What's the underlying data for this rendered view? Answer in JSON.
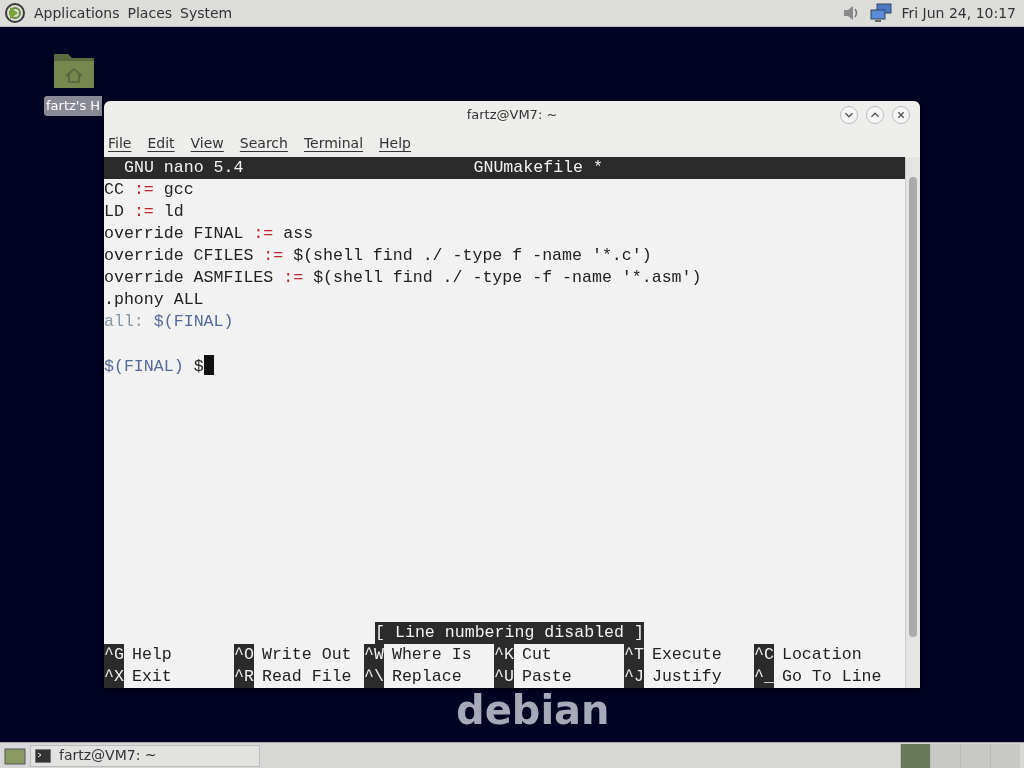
{
  "top_panel": {
    "menus": [
      "Applications",
      "Places",
      "System"
    ],
    "clock": "Fri Jun 24, 10:17"
  },
  "desktop": {
    "icons": [
      {
        "label": "fartz's H"
      }
    ],
    "wallpaper_text": "debian"
  },
  "window": {
    "title": "fartz@VM7: ~",
    "menu": [
      "File",
      "Edit",
      "View",
      "Search",
      "Terminal",
      "Help"
    ]
  },
  "nano": {
    "version": "GNU nano 5.4",
    "filename": "GNUmakefile *",
    "lines": [
      {
        "kind": "code",
        "segments": [
          {
            "text": "CC ",
            "kind": "plain"
          },
          {
            "text": ":=",
            "kind": "operator"
          },
          {
            "text": " gcc",
            "kind": "plain"
          }
        ]
      },
      {
        "kind": "code",
        "segments": [
          {
            "text": "LD ",
            "kind": "plain"
          },
          {
            "text": ":=",
            "kind": "operator"
          },
          {
            "text": " ld",
            "kind": "plain"
          }
        ]
      },
      {
        "kind": "code",
        "segments": [
          {
            "text": "override FINAL ",
            "kind": "plain"
          },
          {
            "text": ":=",
            "kind": "operator"
          },
          {
            "text": " ass",
            "kind": "plain"
          }
        ]
      },
      {
        "kind": "code",
        "segments": [
          {
            "text": "override CFILES ",
            "kind": "plain"
          },
          {
            "text": ":=",
            "kind": "operator"
          },
          {
            "text": " $(shell find ./ -type f -name '*.c')",
            "kind": "plain"
          }
        ]
      },
      {
        "kind": "code",
        "segments": [
          {
            "text": "override ASMFILES ",
            "kind": "plain"
          },
          {
            "text": ":=",
            "kind": "operator"
          },
          {
            "text": " $(shell find ./ -type -f -name '*.asm')",
            "kind": "plain"
          }
        ]
      },
      {
        "kind": "code",
        "segments": [
          {
            "text": ".phony ALL",
            "kind": "plain"
          }
        ]
      },
      {
        "kind": "code",
        "segments": [
          {
            "text": "all:",
            "kind": "target"
          },
          {
            "text": " $(FINAL)",
            "kind": "variable"
          }
        ]
      },
      {
        "kind": "blank"
      },
      {
        "kind": "code",
        "segments": [
          {
            "text": "$(FINAL)",
            "kind": "variable"
          },
          {
            "text": " $",
            "kind": "plain"
          }
        ],
        "cursor": true
      }
    ],
    "status": "[ Line numbering disabled ]",
    "shortcuts": [
      {
        "key": "^G",
        "label": "Help"
      },
      {
        "key": "^O",
        "label": "Write Out"
      },
      {
        "key": "^W",
        "label": "Where Is"
      },
      {
        "key": "^K",
        "label": "Cut"
      },
      {
        "key": "^T",
        "label": "Execute"
      },
      {
        "key": "^C",
        "label": "Location"
      },
      {
        "key": "^X",
        "label": "Exit"
      },
      {
        "key": "^R",
        "label": "Read File"
      },
      {
        "key": "^\\",
        "label": "Replace"
      },
      {
        "key": "^U",
        "label": "Paste"
      },
      {
        "key": "^J",
        "label": "Justify"
      },
      {
        "key": "^_",
        "label": "Go To Line"
      }
    ]
  },
  "taskbar": {
    "tasks": [
      {
        "label": "fartz@VM7: ~"
      }
    ]
  }
}
